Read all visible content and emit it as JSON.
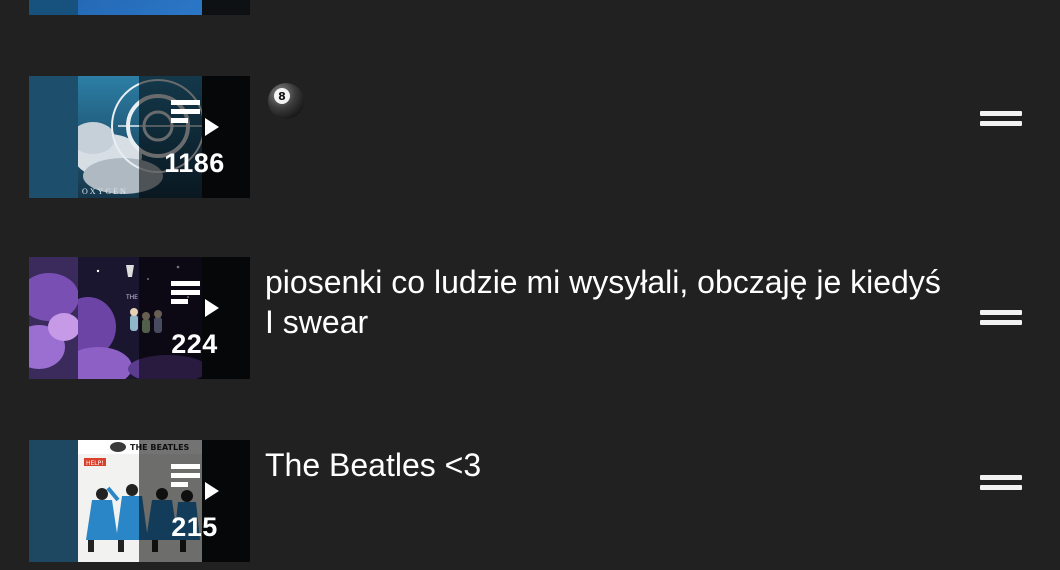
{
  "playlists": [
    {
      "title": "",
      "video_count": "",
      "cover": "blue-sky"
    },
    {
      "title": "",
      "title_icon": "8-ball-emoji-icon",
      "video_count": "1186",
      "cover": "oxygen-clouds"
    },
    {
      "title": "piosenki co ludzie mi wysyłali, obczaję je kiedyś I swear",
      "video_count": "224",
      "cover": "purple-galaxy"
    },
    {
      "title": "The Beatles <3",
      "video_count": "215",
      "cover": "beatles-help"
    }
  ],
  "icons": {
    "playlist": "playlist-play-icon",
    "drag": "drag-handle-icon"
  },
  "colors": {
    "background": "#212121",
    "text": "#ffffff",
    "overlay": "rgba(0,0,0,0.55)"
  }
}
